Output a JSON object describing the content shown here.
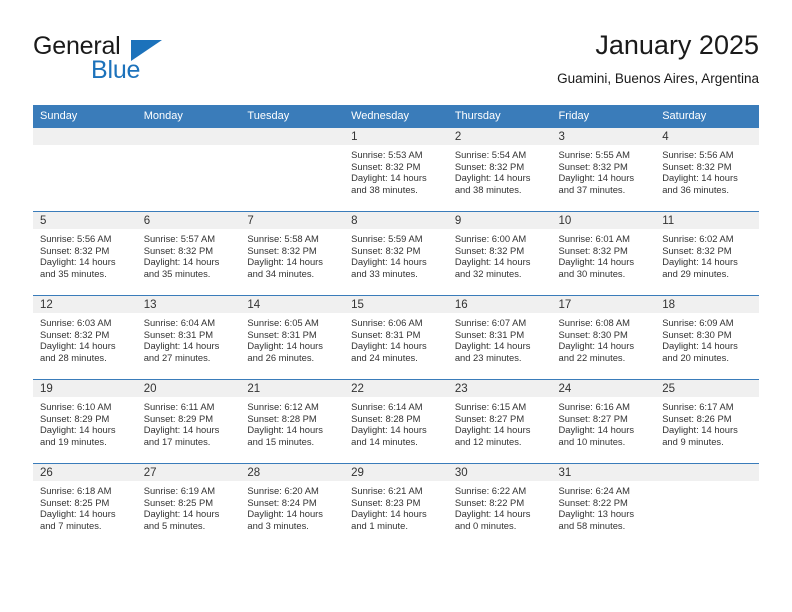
{
  "brand": {
    "name_part1": "General",
    "name_part2": "Blue",
    "logo_icon": "triangle-logo-icon"
  },
  "header": {
    "title": "January 2025",
    "location": "Guamini, Buenos Aires, Argentina"
  },
  "colors": {
    "header_blue": "#3a7cba",
    "brand_blue": "#1c72bb",
    "daynum_strip": "#f0f0f0",
    "text": "#333333"
  },
  "weekday_headers": [
    "Sunday",
    "Monday",
    "Tuesday",
    "Wednesday",
    "Thursday",
    "Friday",
    "Saturday"
  ],
  "labels": {
    "sunrise": "Sunrise:",
    "sunset": "Sunset:",
    "daylight": "Daylight:"
  },
  "weeks": [
    [
      {
        "day": "",
        "l1": "",
        "l2": "",
        "l3": "",
        "l4": ""
      },
      {
        "day": "",
        "l1": "",
        "l2": "",
        "l3": "",
        "l4": ""
      },
      {
        "day": "",
        "l1": "",
        "l2": "",
        "l3": "",
        "l4": ""
      },
      {
        "day": "1",
        "l1": "Sunrise: 5:53 AM",
        "l2": "Sunset: 8:32 PM",
        "l3": "Daylight: 14 hours",
        "l4": "and 38 minutes."
      },
      {
        "day": "2",
        "l1": "Sunrise: 5:54 AM",
        "l2": "Sunset: 8:32 PM",
        "l3": "Daylight: 14 hours",
        "l4": "and 38 minutes."
      },
      {
        "day": "3",
        "l1": "Sunrise: 5:55 AM",
        "l2": "Sunset: 8:32 PM",
        "l3": "Daylight: 14 hours",
        "l4": "and 37 minutes."
      },
      {
        "day": "4",
        "l1": "Sunrise: 5:56 AM",
        "l2": "Sunset: 8:32 PM",
        "l3": "Daylight: 14 hours",
        "l4": "and 36 minutes."
      }
    ],
    [
      {
        "day": "5",
        "l1": "Sunrise: 5:56 AM",
        "l2": "Sunset: 8:32 PM",
        "l3": "Daylight: 14 hours",
        "l4": "and 35 minutes."
      },
      {
        "day": "6",
        "l1": "Sunrise: 5:57 AM",
        "l2": "Sunset: 8:32 PM",
        "l3": "Daylight: 14 hours",
        "l4": "and 35 minutes."
      },
      {
        "day": "7",
        "l1": "Sunrise: 5:58 AM",
        "l2": "Sunset: 8:32 PM",
        "l3": "Daylight: 14 hours",
        "l4": "and 34 minutes."
      },
      {
        "day": "8",
        "l1": "Sunrise: 5:59 AM",
        "l2": "Sunset: 8:32 PM",
        "l3": "Daylight: 14 hours",
        "l4": "and 33 minutes."
      },
      {
        "day": "9",
        "l1": "Sunrise: 6:00 AM",
        "l2": "Sunset: 8:32 PM",
        "l3": "Daylight: 14 hours",
        "l4": "and 32 minutes."
      },
      {
        "day": "10",
        "l1": "Sunrise: 6:01 AM",
        "l2": "Sunset: 8:32 PM",
        "l3": "Daylight: 14 hours",
        "l4": "and 30 minutes."
      },
      {
        "day": "11",
        "l1": "Sunrise: 6:02 AM",
        "l2": "Sunset: 8:32 PM",
        "l3": "Daylight: 14 hours",
        "l4": "and 29 minutes."
      }
    ],
    [
      {
        "day": "12",
        "l1": "Sunrise: 6:03 AM",
        "l2": "Sunset: 8:32 PM",
        "l3": "Daylight: 14 hours",
        "l4": "and 28 minutes."
      },
      {
        "day": "13",
        "l1": "Sunrise: 6:04 AM",
        "l2": "Sunset: 8:31 PM",
        "l3": "Daylight: 14 hours",
        "l4": "and 27 minutes."
      },
      {
        "day": "14",
        "l1": "Sunrise: 6:05 AM",
        "l2": "Sunset: 8:31 PM",
        "l3": "Daylight: 14 hours",
        "l4": "and 26 minutes."
      },
      {
        "day": "15",
        "l1": "Sunrise: 6:06 AM",
        "l2": "Sunset: 8:31 PM",
        "l3": "Daylight: 14 hours",
        "l4": "and 24 minutes."
      },
      {
        "day": "16",
        "l1": "Sunrise: 6:07 AM",
        "l2": "Sunset: 8:31 PM",
        "l3": "Daylight: 14 hours",
        "l4": "and 23 minutes."
      },
      {
        "day": "17",
        "l1": "Sunrise: 6:08 AM",
        "l2": "Sunset: 8:30 PM",
        "l3": "Daylight: 14 hours",
        "l4": "and 22 minutes."
      },
      {
        "day": "18",
        "l1": "Sunrise: 6:09 AM",
        "l2": "Sunset: 8:30 PM",
        "l3": "Daylight: 14 hours",
        "l4": "and 20 minutes."
      }
    ],
    [
      {
        "day": "19",
        "l1": "Sunrise: 6:10 AM",
        "l2": "Sunset: 8:29 PM",
        "l3": "Daylight: 14 hours",
        "l4": "and 19 minutes."
      },
      {
        "day": "20",
        "l1": "Sunrise: 6:11 AM",
        "l2": "Sunset: 8:29 PM",
        "l3": "Daylight: 14 hours",
        "l4": "and 17 minutes."
      },
      {
        "day": "21",
        "l1": "Sunrise: 6:12 AM",
        "l2": "Sunset: 8:28 PM",
        "l3": "Daylight: 14 hours",
        "l4": "and 15 minutes."
      },
      {
        "day": "22",
        "l1": "Sunrise: 6:14 AM",
        "l2": "Sunset: 8:28 PM",
        "l3": "Daylight: 14 hours",
        "l4": "and 14 minutes."
      },
      {
        "day": "23",
        "l1": "Sunrise: 6:15 AM",
        "l2": "Sunset: 8:27 PM",
        "l3": "Daylight: 14 hours",
        "l4": "and 12 minutes."
      },
      {
        "day": "24",
        "l1": "Sunrise: 6:16 AM",
        "l2": "Sunset: 8:27 PM",
        "l3": "Daylight: 14 hours",
        "l4": "and 10 minutes."
      },
      {
        "day": "25",
        "l1": "Sunrise: 6:17 AM",
        "l2": "Sunset: 8:26 PM",
        "l3": "Daylight: 14 hours",
        "l4": "and 9 minutes."
      }
    ],
    [
      {
        "day": "26",
        "l1": "Sunrise: 6:18 AM",
        "l2": "Sunset: 8:25 PM",
        "l3": "Daylight: 14 hours",
        "l4": "and 7 minutes."
      },
      {
        "day": "27",
        "l1": "Sunrise: 6:19 AM",
        "l2": "Sunset: 8:25 PM",
        "l3": "Daylight: 14 hours",
        "l4": "and 5 minutes."
      },
      {
        "day": "28",
        "l1": "Sunrise: 6:20 AM",
        "l2": "Sunset: 8:24 PM",
        "l3": "Daylight: 14 hours",
        "l4": "and 3 minutes."
      },
      {
        "day": "29",
        "l1": "Sunrise: 6:21 AM",
        "l2": "Sunset: 8:23 PM",
        "l3": "Daylight: 14 hours",
        "l4": "and 1 minute."
      },
      {
        "day": "30",
        "l1": "Sunrise: 6:22 AM",
        "l2": "Sunset: 8:22 PM",
        "l3": "Daylight: 14 hours",
        "l4": "and 0 minutes."
      },
      {
        "day": "31",
        "l1": "Sunrise: 6:24 AM",
        "l2": "Sunset: 8:22 PM",
        "l3": "Daylight: 13 hours",
        "l4": "and 58 minutes."
      },
      {
        "day": "",
        "l1": "",
        "l2": "",
        "l3": "",
        "l4": ""
      }
    ]
  ]
}
